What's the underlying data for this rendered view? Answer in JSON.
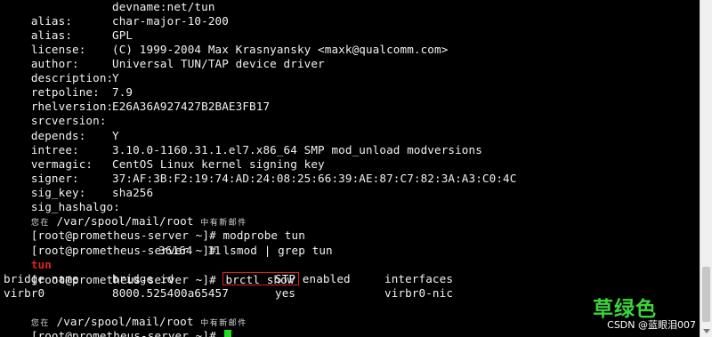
{
  "modinfo": [
    {
      "key": "alias:",
      "value": "devname:net/tun"
    },
    {
      "key": "alias:",
      "value": "char-major-10-200"
    },
    {
      "key": "license:",
      "value": "GPL"
    },
    {
      "key": "author:",
      "value": "(C) 1999-2004 Max Krasnyansky <maxk@qualcomm.com>"
    },
    {
      "key": "description:",
      "value": "Universal TUN/TAP device driver"
    },
    {
      "key": "retpoline:",
      "value": "Y"
    },
    {
      "key": "rhelversion:",
      "value": "7.9"
    },
    {
      "key": "srcversion:",
      "value": "E26A36A927427B2BAE3FB17"
    },
    {
      "key": "depends:",
      "value": ""
    },
    {
      "key": "intree:",
      "value": "Y"
    },
    {
      "key": "vermagic:",
      "value": "3.10.0-1160.31.1.el7.x86_64 SMP mod_unload modversions"
    },
    {
      "key": "signer:",
      "value": "CentOS Linux kernel signing key"
    },
    {
      "key": "sig_key:",
      "value": "37:AF:3B:F2:19:74:AD:24:08:25:66:39:AE:87:C7:82:3A:A3:C0:4C"
    },
    {
      "key": "sig_hashalgo:",
      "value": "sha256"
    }
  ],
  "mail_notice_1": {
    "prefix": "您在",
    "path": " /var/spool/mail/root ",
    "suffix": "中有新邮件"
  },
  "prompt": "[root@prometheus-server ~]# ",
  "cmd_modprobe": "modprobe tun",
  "cmd_lsmod": "lsmod | grep tun",
  "lsmod_result": {
    "name": "tun",
    "size": "36164",
    "used": "11"
  },
  "cmd_brctl": "brctl show",
  "brctl_headers": [
    "bridge name",
    "bridge id",
    "STP enabled",
    "interfaces"
  ],
  "brctl_row": [
    "virbr0",
    "8000.525400a65457",
    "yes",
    "virbr0-nic"
  ],
  "mail_notice_2": {
    "prefix": "您在",
    "path": " /var/spool/mail/root ",
    "suffix": "中有新邮件"
  },
  "watermark": "草绿色",
  "csdn_credit": "CSDN @蓝眼泪007",
  "colors": {
    "background": "#000000",
    "text": "#f2f2f2",
    "highlight": "#e02020",
    "cursor": "#22dd22",
    "watermark": "#3cd43c"
  }
}
